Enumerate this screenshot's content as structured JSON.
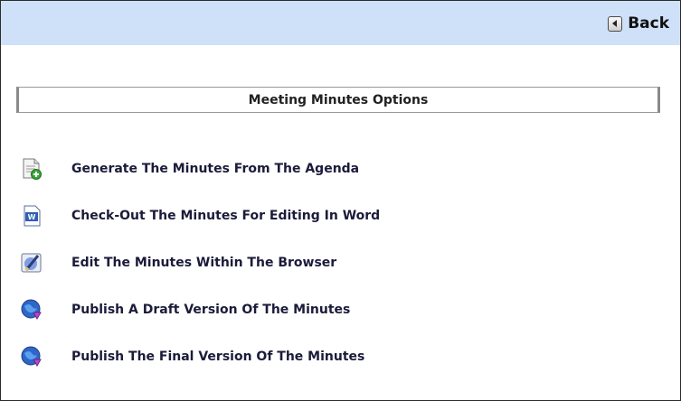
{
  "header": {
    "back_label": "Back",
    "back_icon": "left-arrow-icon"
  },
  "section": {
    "title": "Meeting Minutes Options"
  },
  "options": [
    {
      "label": "Generate The Minutes From The Agenda",
      "icon": "document-add-icon"
    },
    {
      "label": "Check-Out The Minutes For Editing In Word",
      "icon": "word-document-icon"
    },
    {
      "label": "Edit The Minutes Within The Browser",
      "icon": "edit-pencil-icon"
    },
    {
      "label": "Publish A Draft Version Of The Minutes",
      "icon": "publish-globe-icon"
    },
    {
      "label": "Publish The Final Version Of The Minutes",
      "icon": "publish-globe-icon"
    }
  ],
  "colors": {
    "topbar": "#cfe1f9",
    "text": "#1b1b3a"
  }
}
